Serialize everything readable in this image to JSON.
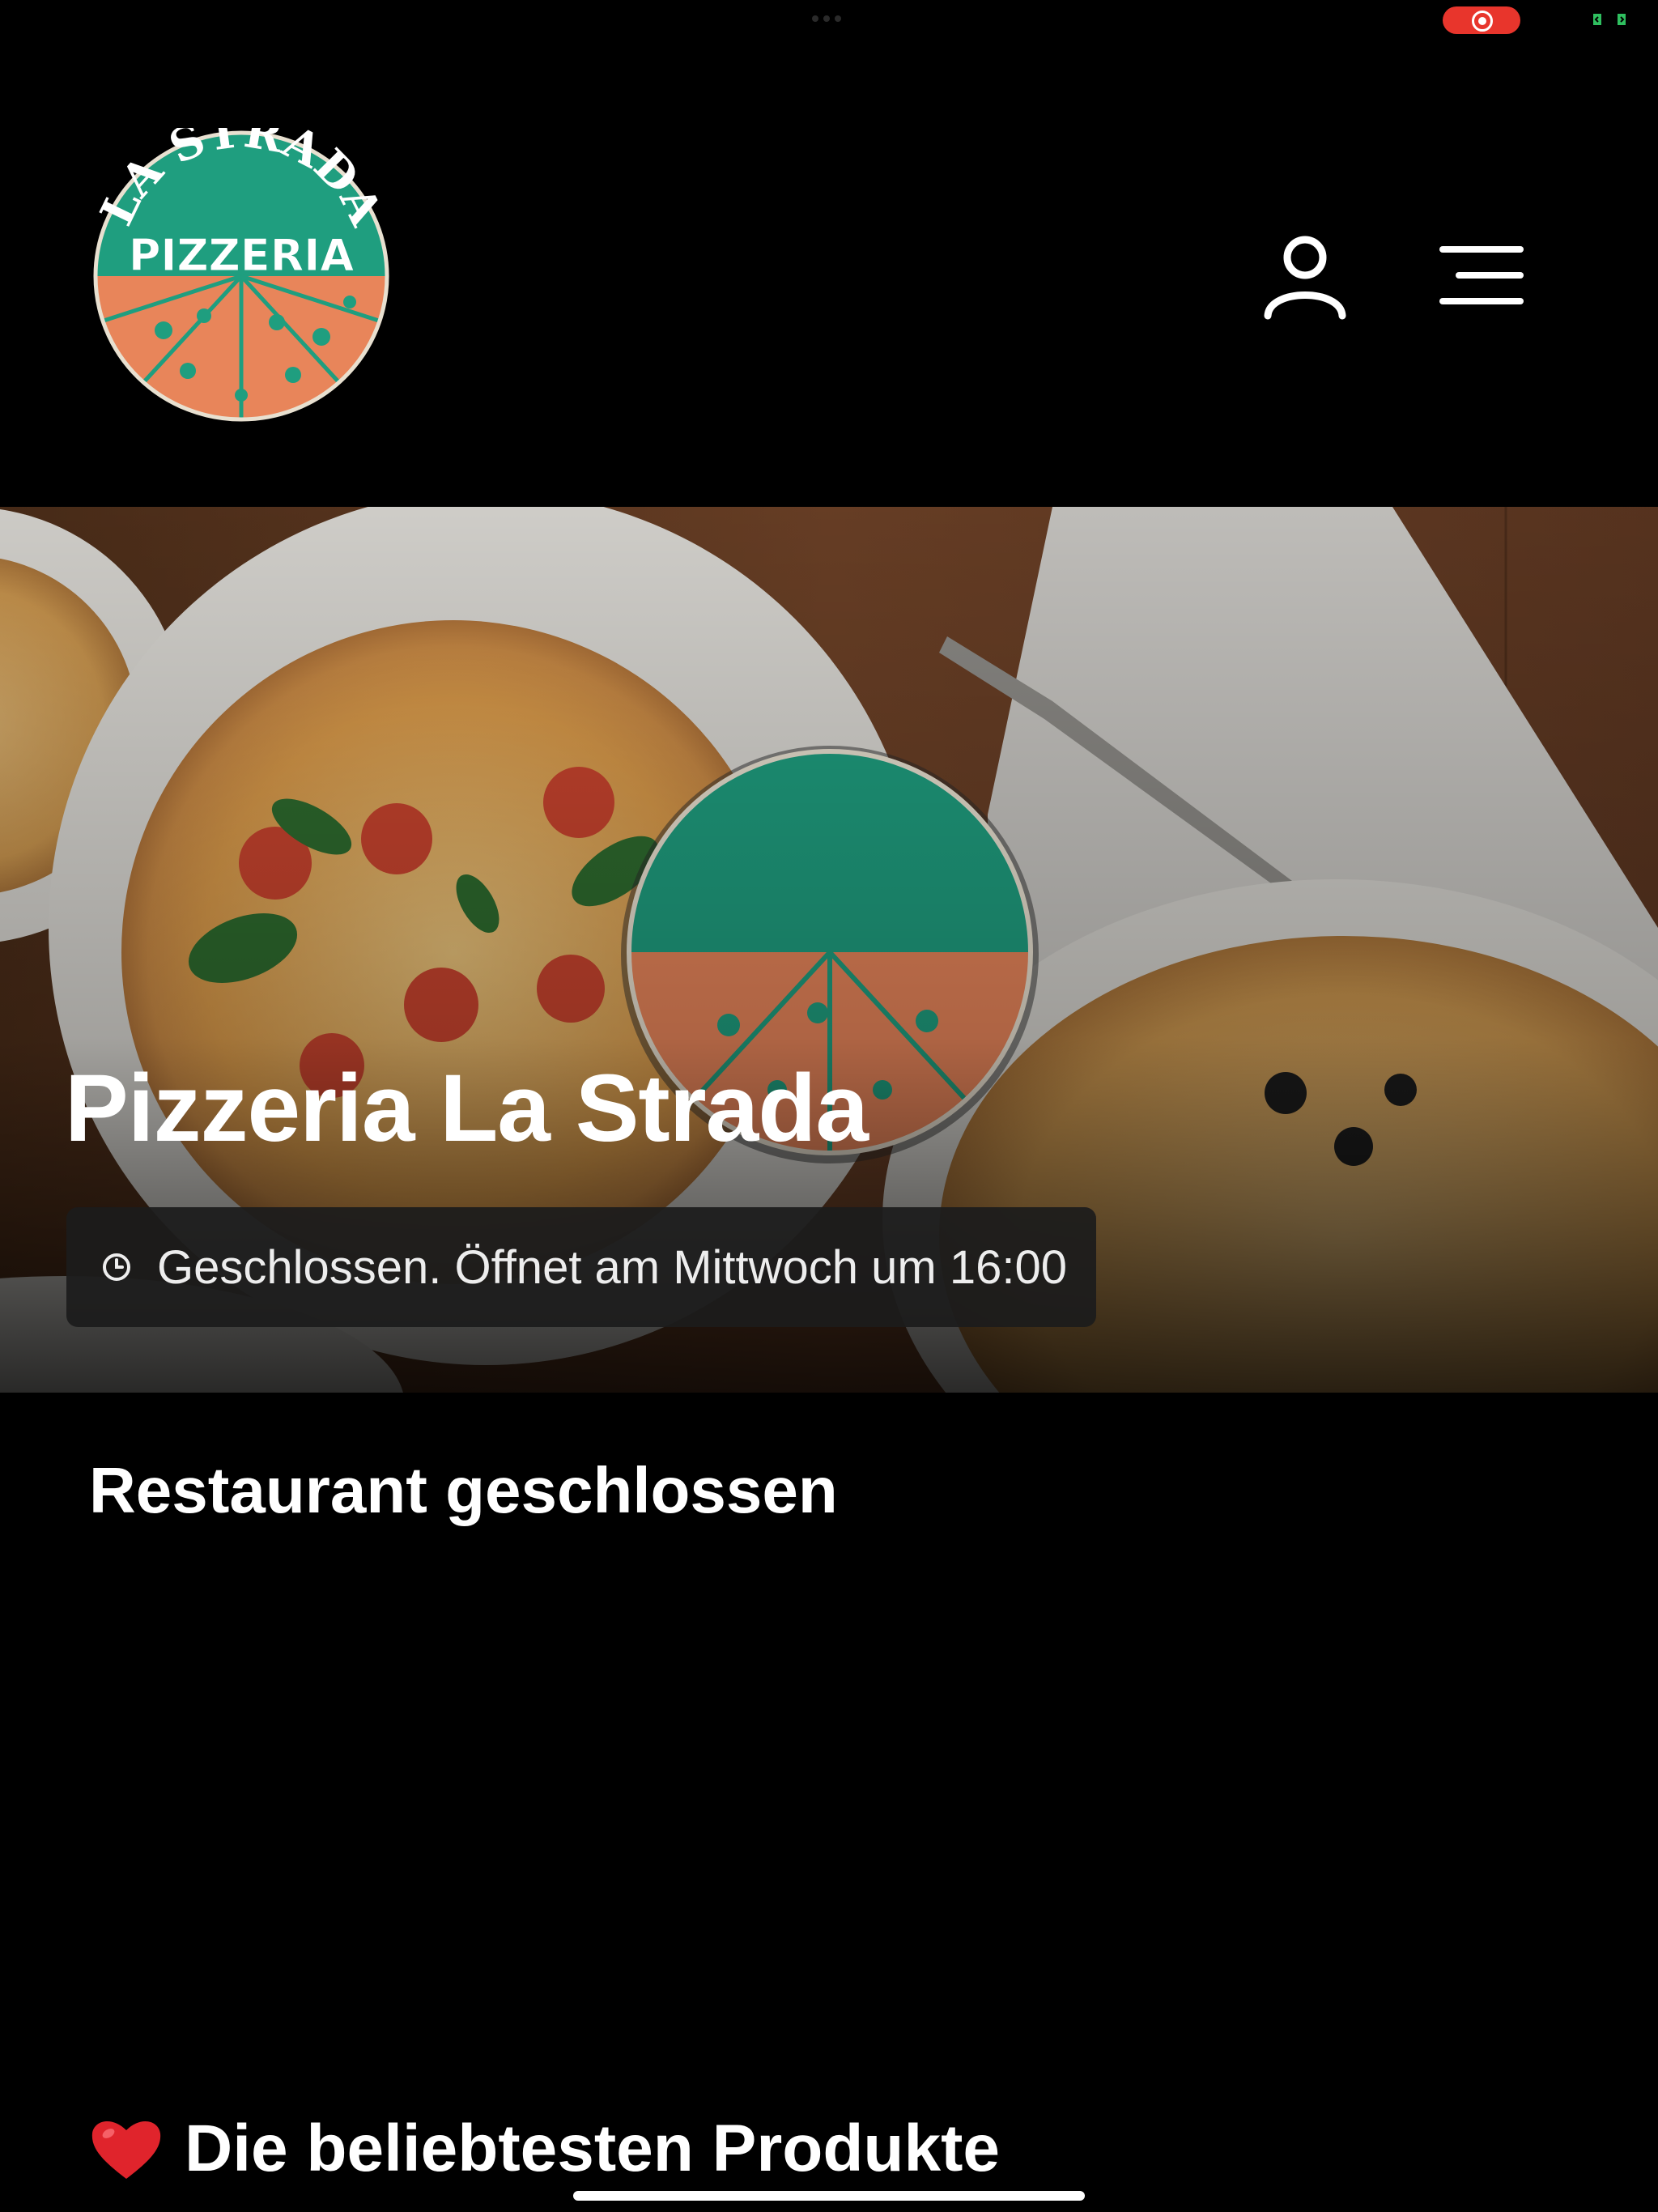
{
  "restaurant": {
    "name": "Pizzeria La Strada",
    "logo_text_top": "LA STRADA",
    "logo_text_bottom": "PIZZERIA"
  },
  "header": {
    "user_icon": "user-icon",
    "menu_icon": "hamburger-menu-icon"
  },
  "hero": {
    "status": "Geschlossen. Öffnet am Mittwoch um 16:00",
    "status_icon": "clock-icon"
  },
  "sections": {
    "closed_heading": "Restaurant geschlossen",
    "popular_heading": "Die beliebtesten Produkte",
    "popular_icon": "heart-icon"
  },
  "colors": {
    "background": "#000000",
    "logo_green": "#1f9e7f",
    "logo_orange": "#e8855a",
    "recording": "#e8352c"
  }
}
